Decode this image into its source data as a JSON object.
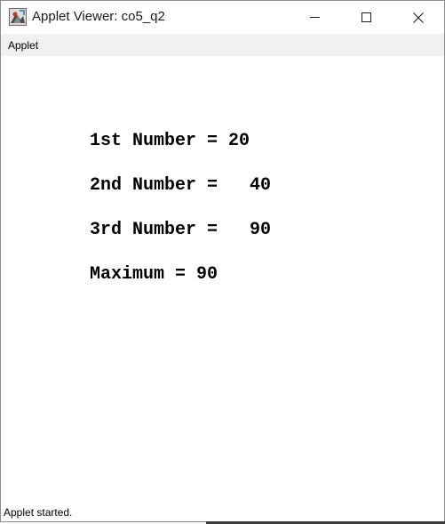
{
  "window": {
    "title": "Applet Viewer: co5_q2",
    "icon": "java-applet-icon"
  },
  "controls": {
    "minimize_icon": "minimize-icon",
    "maximize_icon": "maximize-icon",
    "close_icon": "close-icon"
  },
  "menubar": {
    "items": [
      {
        "label": "Applet"
      }
    ]
  },
  "output": {
    "lines": [
      {
        "text": "1st Number = 20"
      },
      {
        "text": "2nd Number =   40"
      },
      {
        "text": "3rd Number =   90"
      },
      {
        "text": "Maximum = 90"
      }
    ]
  },
  "status": {
    "text": "Applet started."
  }
}
